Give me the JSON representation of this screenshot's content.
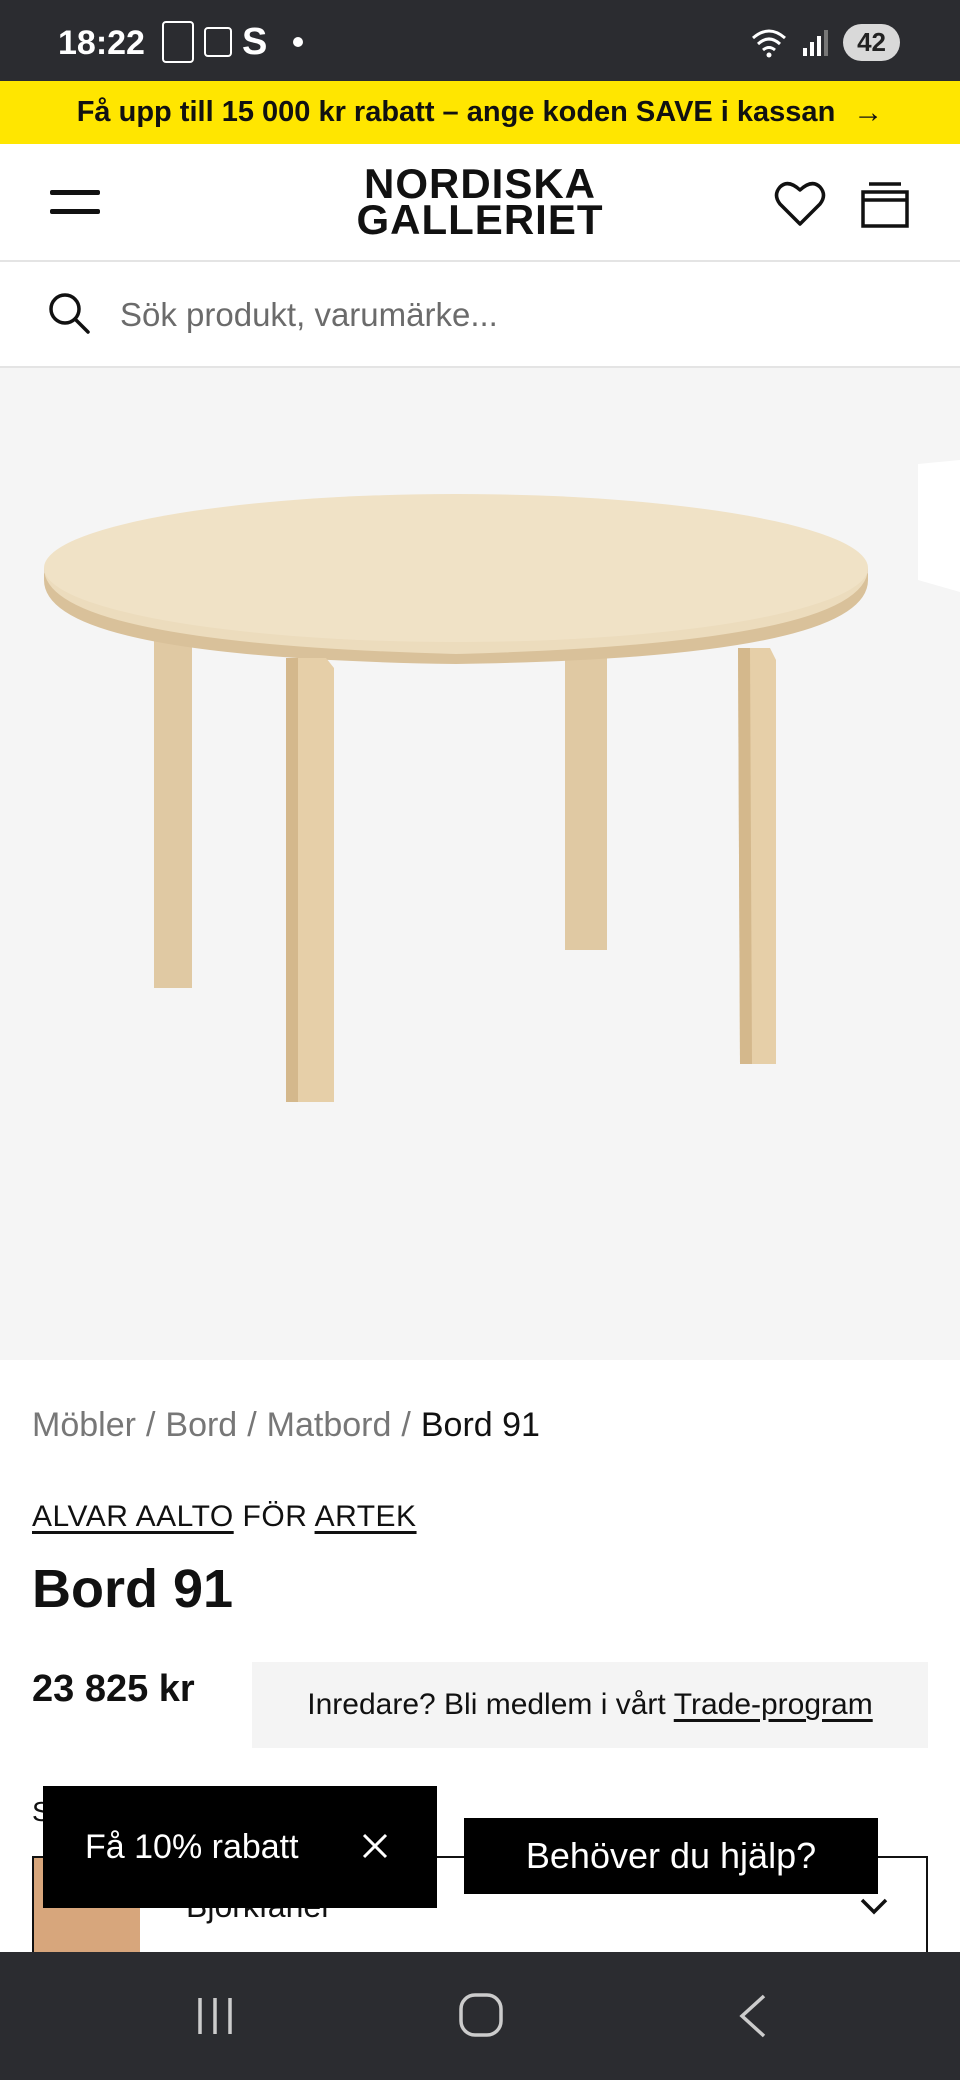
{
  "status_bar": {
    "time": "18:22",
    "battery": "42",
    "network": "5"
  },
  "promo_banner": {
    "text": "Få upp till 15 000 kr rabatt – ange koden SAVE i kassan",
    "arrow": "→"
  },
  "header": {
    "logo_line1": "NORDISKA",
    "logo_line2": "GALLERIET",
    "icons": [
      "menu-icon",
      "heart-icon",
      "cart-icon"
    ]
  },
  "search": {
    "placeholder": "Sök produkt, varumärke..."
  },
  "breadcrumb": {
    "items": [
      "Möbler",
      "Bord",
      "Matbord"
    ],
    "current": "Bord 91",
    "separator": "/"
  },
  "product": {
    "designer": "ALVAR AALTO",
    "for_text": "FÖR",
    "brand": "ARTEK",
    "title": "Bord 91",
    "price": "23 825 kr"
  },
  "trade": {
    "text": "Inredare? Bli medlem i vårt",
    "link": "Trade-program"
  },
  "variant": {
    "label_stub": "S",
    "selected": "Björkfaner",
    "swatch_color": "#d7a67c"
  },
  "discount_popup": {
    "text": "Få 10% rabatt",
    "close": "✕"
  },
  "help": {
    "label": "Behöver du hjälp?"
  },
  "colors": {
    "banner": "#ffe600",
    "status_bar": "#2b2c30",
    "image_bg": "#f5f5f5",
    "wood": "#e8d4b0"
  }
}
